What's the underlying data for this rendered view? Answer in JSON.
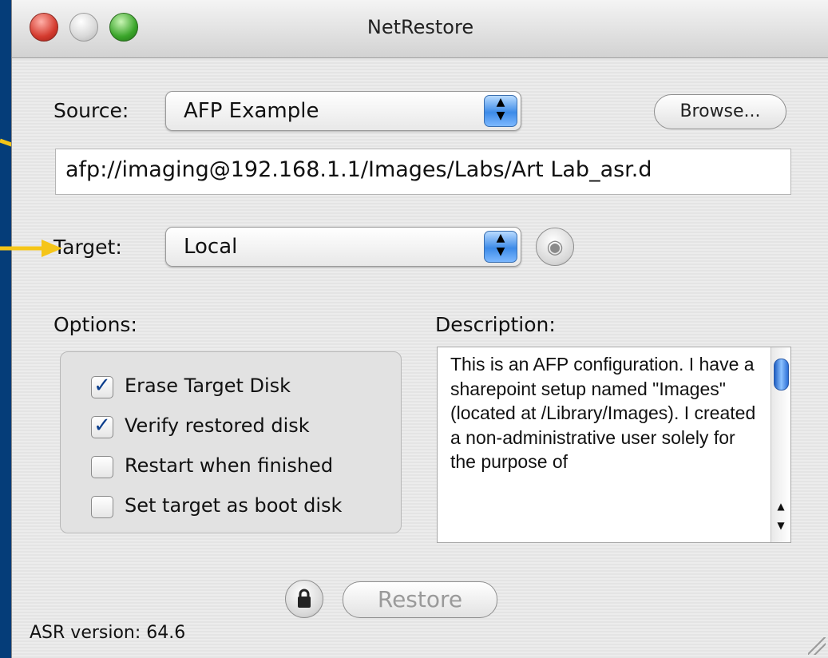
{
  "window": {
    "title": "NetRestore"
  },
  "source": {
    "label": "Source:",
    "selected": "AFP Example",
    "browse_label": "Browse...",
    "url": "afp://imaging@192.168.1.1/Images/Labs/Art Lab_asr.d"
  },
  "target": {
    "label": "Target:",
    "selected": "Local"
  },
  "options": {
    "label": "Options:",
    "items": [
      {
        "label": "Erase Target Disk",
        "checked": true
      },
      {
        "label": "Verify restored disk",
        "checked": true
      },
      {
        "label": "Restart when finished",
        "checked": false
      },
      {
        "label": "Set target as boot disk",
        "checked": false
      }
    ]
  },
  "description": {
    "label": "Description:",
    "text": "This is an AFP configuration.  I have a sharepoint setup named \"Images\" (located at /Library/Images). I created a non-administrative user solely for the purpose of"
  },
  "restore_label": "Restore",
  "asr_version": "ASR version: 64.6",
  "icons": {
    "lock": "lock-icon",
    "refresh": "refresh-icon",
    "callout": "yellow-arrow-icon"
  },
  "colors": {
    "desktop": "#053d79",
    "accent": "#3d8be8",
    "callout": "#f5c518"
  }
}
